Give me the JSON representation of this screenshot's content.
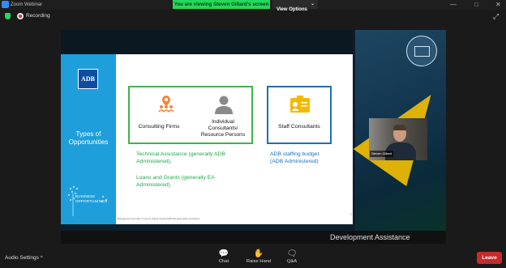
{
  "window": {
    "app_title": "Zoom Webinar",
    "banner_text": "You are viewing Steven Gillard's screen",
    "view_options_label": "View Options",
    "controls": [
      "—",
      "□",
      "✕"
    ]
  },
  "status": {
    "recording_label": "Recording"
  },
  "slide": {
    "logo_text": "ADB",
    "sidebar_title": "Types of\nOpportunities",
    "sidebar_logo_text": "BUSINESS\nOPPORTUNITIES",
    "box_green": {
      "item1_label": "Consulting Firms",
      "item2_label": "Individual\nConsultants/\nResource Persons"
    },
    "box_blue": {
      "item_label": "Staff Consultants"
    },
    "ta_text": "Technical Assistance (generally ADB\nAdministered),",
    "loans_text": "Loans and Grants (generally EA\nAdministered)",
    "budget_text": "ADB staffing budget\n(ADB Administered)",
    "footer_text": "Management and staff. It may be shared outside ADB with appropriate permission.",
    "page_number": "2"
  },
  "background": {
    "bottom_caption": "Development Assistance"
  },
  "video": {
    "participant_name": "Steven Gillard"
  },
  "toolbar": {
    "audio_settings_label": "Audio Settings",
    "audio_chevron": "^",
    "chat_label": "Chat",
    "raise_hand_label": "Raise Hand",
    "qa_label": "Q&A",
    "leave_label": "Leave"
  },
  "colors": {
    "banner": "#23d959",
    "slide_accent": "#1e9fdc",
    "green_box": "#3cb54a",
    "blue_box": "#1f6fb5",
    "leave": "#c62a2a"
  }
}
